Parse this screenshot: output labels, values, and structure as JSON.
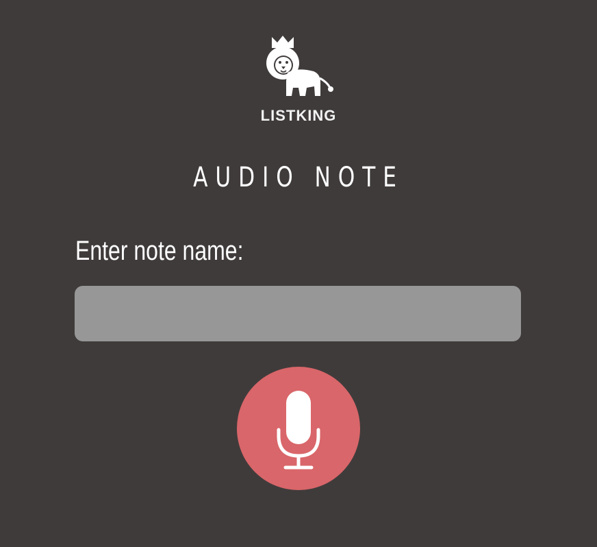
{
  "brand": {
    "name": "LISTKING",
    "logo_icon": "lion-with-crown-icon"
  },
  "page": {
    "title": "AUDIO NOTE"
  },
  "form": {
    "label": "Enter note name:",
    "input_value": "",
    "input_placeholder": ""
  },
  "record_button": {
    "icon": "microphone-icon",
    "color": "#d9666a"
  },
  "colors": {
    "background": "#403b3b",
    "input_background": "#979797",
    "text": "#ffffff"
  }
}
